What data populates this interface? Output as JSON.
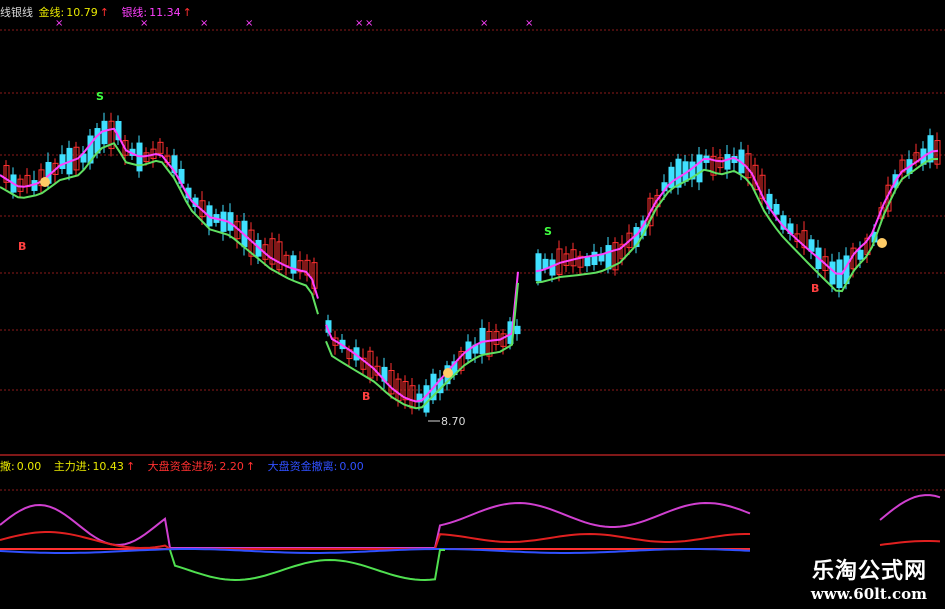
{
  "top_legend": {
    "indicator": "线银线",
    "gold_label": "金线:",
    "gold_value": "10.79",
    "silver_label": "银线:",
    "silver_value": "11.34",
    "arrow": "↑"
  },
  "bottom_legend": {
    "items": [
      {
        "label": "撒:",
        "value": "0.00",
        "color": "#40ff40"
      },
      {
        "label": "主力进:",
        "value": "10.43",
        "arrow": "↑",
        "color": "#ff40ff"
      },
      {
        "label": "大盘资金进场:",
        "value": "2.20",
        "arrow": "↑",
        "color": "#ff3030"
      },
      {
        "label": "大盘资金撤离:",
        "value": "0.00",
        "color": "#3050ff"
      }
    ]
  },
  "annotations": {
    "low_price": "8.70",
    "signal_buy": "B",
    "signal_sell": "S"
  },
  "watermark": {
    "title": "乐淘公式网",
    "url": "www.60lt.com"
  },
  "colors": {
    "up_candle": "#ff3030",
    "down_candle": "#40e0ff",
    "gold_line": "#ff40ff",
    "silver_line": "#60e060",
    "grid": "#8b1a1a",
    "separator": "#ff3030",
    "cross_marker": "#ff40ff"
  }
}
